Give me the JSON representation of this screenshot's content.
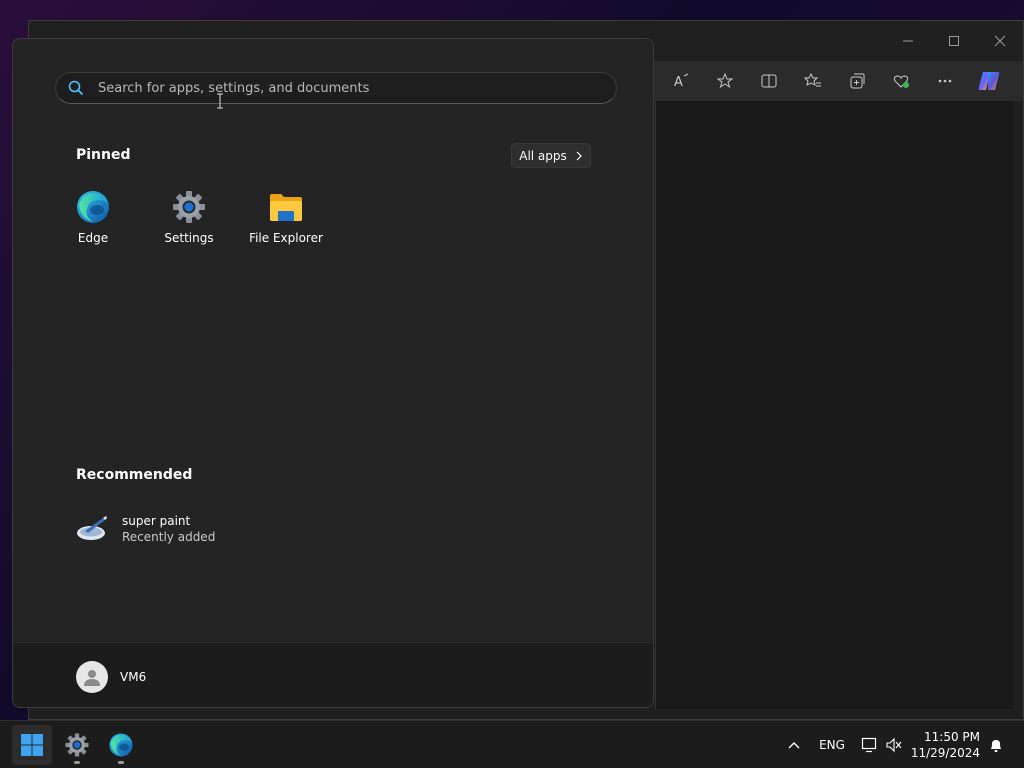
{
  "search": {
    "placeholder": "Search for apps, settings, and documents"
  },
  "pinned": {
    "title": "Pinned",
    "all_apps_label": "All apps",
    "apps": [
      {
        "label": "Edge",
        "icon": "edge-icon"
      },
      {
        "label": "Settings",
        "icon": "gear-icon"
      },
      {
        "label": "File Explorer",
        "icon": "folder-icon"
      }
    ]
  },
  "recommended": {
    "title": "Recommended",
    "items": [
      {
        "name": "super paint",
        "subtitle": "Recently added",
        "icon": "paint-icon"
      }
    ]
  },
  "user": {
    "name": "VM6"
  },
  "taskbar": {
    "language": "ENG",
    "time": "11:50 PM",
    "date": "11/29/2024"
  },
  "colors": {
    "menu_bg": "#242424",
    "accent": "#0078d4",
    "taskbar_bg": "#1c1c1c"
  }
}
